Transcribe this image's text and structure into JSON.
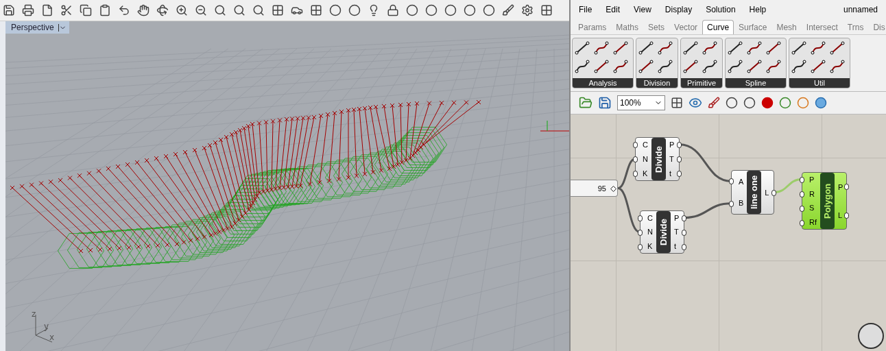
{
  "viewport": {
    "tab": "Perspective",
    "axes": [
      "z",
      "y",
      "x"
    ]
  },
  "grasshopper": {
    "menu": [
      "File",
      "Edit",
      "View",
      "Display",
      "Solution",
      "Help"
    ],
    "document": "unnamed",
    "tabs": [
      {
        "label": "Params",
        "selected": false
      },
      {
        "label": "Maths",
        "selected": false
      },
      {
        "label": "Sets",
        "selected": false
      },
      {
        "label": "Vector",
        "selected": false
      },
      {
        "label": "Curve",
        "selected": true
      },
      {
        "label": "Surface",
        "selected": false
      },
      {
        "label": "Mesh",
        "selected": false
      },
      {
        "label": "Intersect",
        "selected": false
      },
      {
        "label": "Trns",
        "selected": false
      },
      {
        "label": "Dis",
        "selected": false
      }
    ],
    "panels": [
      "Analysis",
      "Division",
      "Primitive",
      "Spline",
      "Util"
    ],
    "zoom": "100%",
    "slider": {
      "value": "95",
      "level": 0.95
    },
    "components": [
      {
        "name": "Divide",
        "inputs": [
          "C",
          "N",
          "K"
        ],
        "outputs": [
          "P",
          "T",
          "t"
        ],
        "selected": false
      },
      {
        "name": "Divide",
        "inputs": [
          "C",
          "N",
          "K"
        ],
        "outputs": [
          "P",
          "T",
          "t"
        ],
        "selected": false
      },
      {
        "name": "line one",
        "inputs": [
          "A",
          "B"
        ],
        "outputs": [
          "L"
        ],
        "selected": false
      },
      {
        "name": "Polygon",
        "inputs": [
          "P",
          "R",
          "S",
          "Rf"
        ],
        "outputs": [
          "P",
          "L"
        ],
        "selected": true
      }
    ]
  }
}
